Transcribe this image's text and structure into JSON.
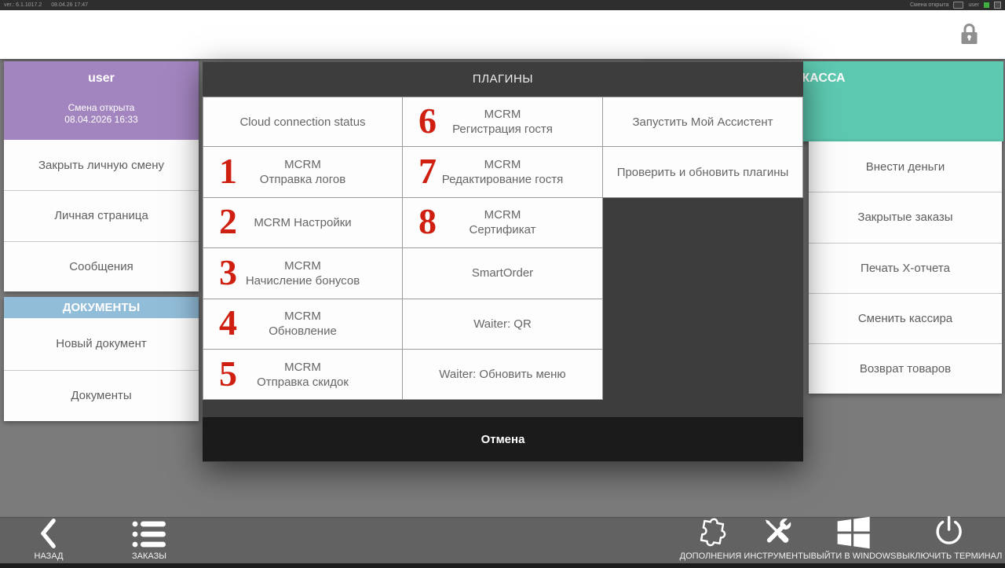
{
  "titlebar": {
    "version": "ver.: 6.1.1017.2",
    "datetime": "08.04.26 17:47",
    "shift_status": "Смена открыта",
    "user_label": "user"
  },
  "user_panel": {
    "title": "user",
    "status_line1": "Смена открыта",
    "status_line2": "08.04.2026 16:33",
    "buttons": [
      "Закрыть личную смену",
      "Личная страница",
      "Сообщения"
    ]
  },
  "documents_panel": {
    "title": "ДОКУМЕНТЫ",
    "buttons": [
      "Новый документ",
      "Документы"
    ]
  },
  "cash_panel": {
    "title": "КАССА",
    "buttons": [
      "Внести деньги",
      "Закрытые заказы",
      "Печать X-отчета",
      "Сменить кассира",
      "Возврат товаров"
    ]
  },
  "modal": {
    "title": "ПЛАГИНЫ",
    "cancel_label": "Отмена",
    "col1": [
      {
        "badge": "",
        "line1": "Cloud connection status",
        "line2": ""
      },
      {
        "badge": "1",
        "line1": "MCRM",
        "line2": "Отправка логов"
      },
      {
        "badge": "2",
        "line1": "MCRM Настройки",
        "line2": ""
      },
      {
        "badge": "3",
        "line1": "MCRM",
        "line2": "Начисление бонусов"
      },
      {
        "badge": "4",
        "line1": "MCRM",
        "line2": "Обновление"
      },
      {
        "badge": "5",
        "line1": "MCRM",
        "line2": "Отправка скидок"
      }
    ],
    "col2": [
      {
        "badge": "6",
        "line1": "MCRM",
        "line2": "Регистрация гостя"
      },
      {
        "badge": "7",
        "line1": "MCRM",
        "line2": "Редактирование гостя"
      },
      {
        "badge": "8",
        "line1": "MCRM",
        "line2": "Сертификат"
      },
      {
        "badge": "",
        "line1": "SmartOrder",
        "line2": ""
      },
      {
        "badge": "",
        "line1": "Waiter: QR",
        "line2": ""
      },
      {
        "badge": "",
        "line1": "Waiter: Обновить меню",
        "line2": ""
      }
    ],
    "col3": [
      {
        "line1": "Запустить Мой Ассистент"
      },
      {
        "line1": "Проверить и обновить плагины"
      }
    ]
  },
  "toolbar": {
    "back": "НАЗАД",
    "orders": "ЗАКАЗЫ",
    "addons": "ДОПОЛНЕНИЯ",
    "tools": "ИНСТРУМЕНТЫ",
    "exit_windows": "ВЫЙТИ В WINDOWS",
    "shutdown": "ВЫКЛЮЧИТЬ ТЕРМИНАЛ"
  },
  "colors": {
    "user_header": "#a285be",
    "documents_header": "#92bdd9",
    "cash_header": "#5dc9b0",
    "annotation_red": "#cf1f10",
    "modal_bg": "#3d3d3d",
    "cancel_bg": "#1b1b1b"
  }
}
